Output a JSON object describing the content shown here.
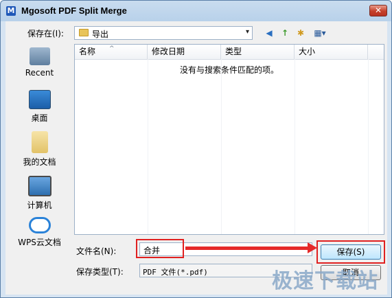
{
  "window": {
    "title": "Mgosoft PDF Split Merge",
    "close_glyph": "✕"
  },
  "save_in": {
    "label": "保存在(I):",
    "value": "导出",
    "arrow": "▾"
  },
  "toolbar": {
    "back": "◀",
    "up": "↑",
    "new_folder": "✱",
    "view": "▦▾"
  },
  "places": [
    {
      "label": "Recent",
      "icon": "recent-icon"
    },
    {
      "label": "桌面",
      "icon": "desktop-icon"
    },
    {
      "label": "我的文档",
      "icon": "documents-icon"
    },
    {
      "label": "计算机",
      "icon": "computer-icon"
    },
    {
      "label": "WPS云文档",
      "icon": "cloud-icon"
    }
  ],
  "file_list": {
    "columns": [
      "名称",
      "修改日期",
      "类型",
      "大小"
    ],
    "sort_indicator": "^",
    "empty_message": "没有与搜索条件匹配的项。"
  },
  "filename": {
    "label": "文件名(N):",
    "value": "合并"
  },
  "filetype": {
    "label": "保存类型(T):",
    "value": "PDF 文件(*.pdf)"
  },
  "buttons": {
    "save": "保存(S)",
    "cancel": "取消"
  },
  "watermark": "极速下载站",
  "colors": {
    "highlight": "#e02020",
    "arrow": "#e52a2a",
    "close_button": "#c5402a"
  }
}
